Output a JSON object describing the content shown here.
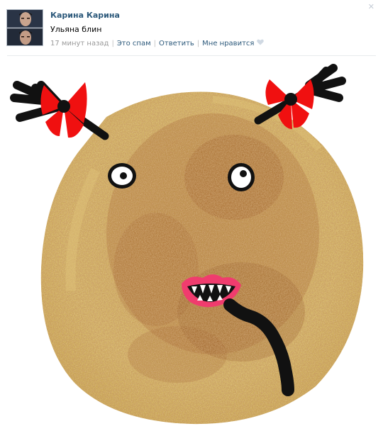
{
  "comment": {
    "author": "Карина Карина",
    "text": "Ульяна блин",
    "time": "17 минут назад",
    "actions": {
      "spam": "Это спам",
      "reply": "Ответить",
      "like": "Мне нравится"
    },
    "close_glyph": "✕",
    "like_icon": "heart-icon",
    "colors": {
      "link": "#2b587a",
      "meta": "#999999",
      "divider": "#e7eaed"
    }
  },
  "picture": {
    "subject": "pancake-face-drawing",
    "colors": {
      "pancake": "#d3b160",
      "browned": "#9a5e2c",
      "bow": "#f01010",
      "ink": "#111111",
      "lips": "#f03c6e"
    }
  }
}
